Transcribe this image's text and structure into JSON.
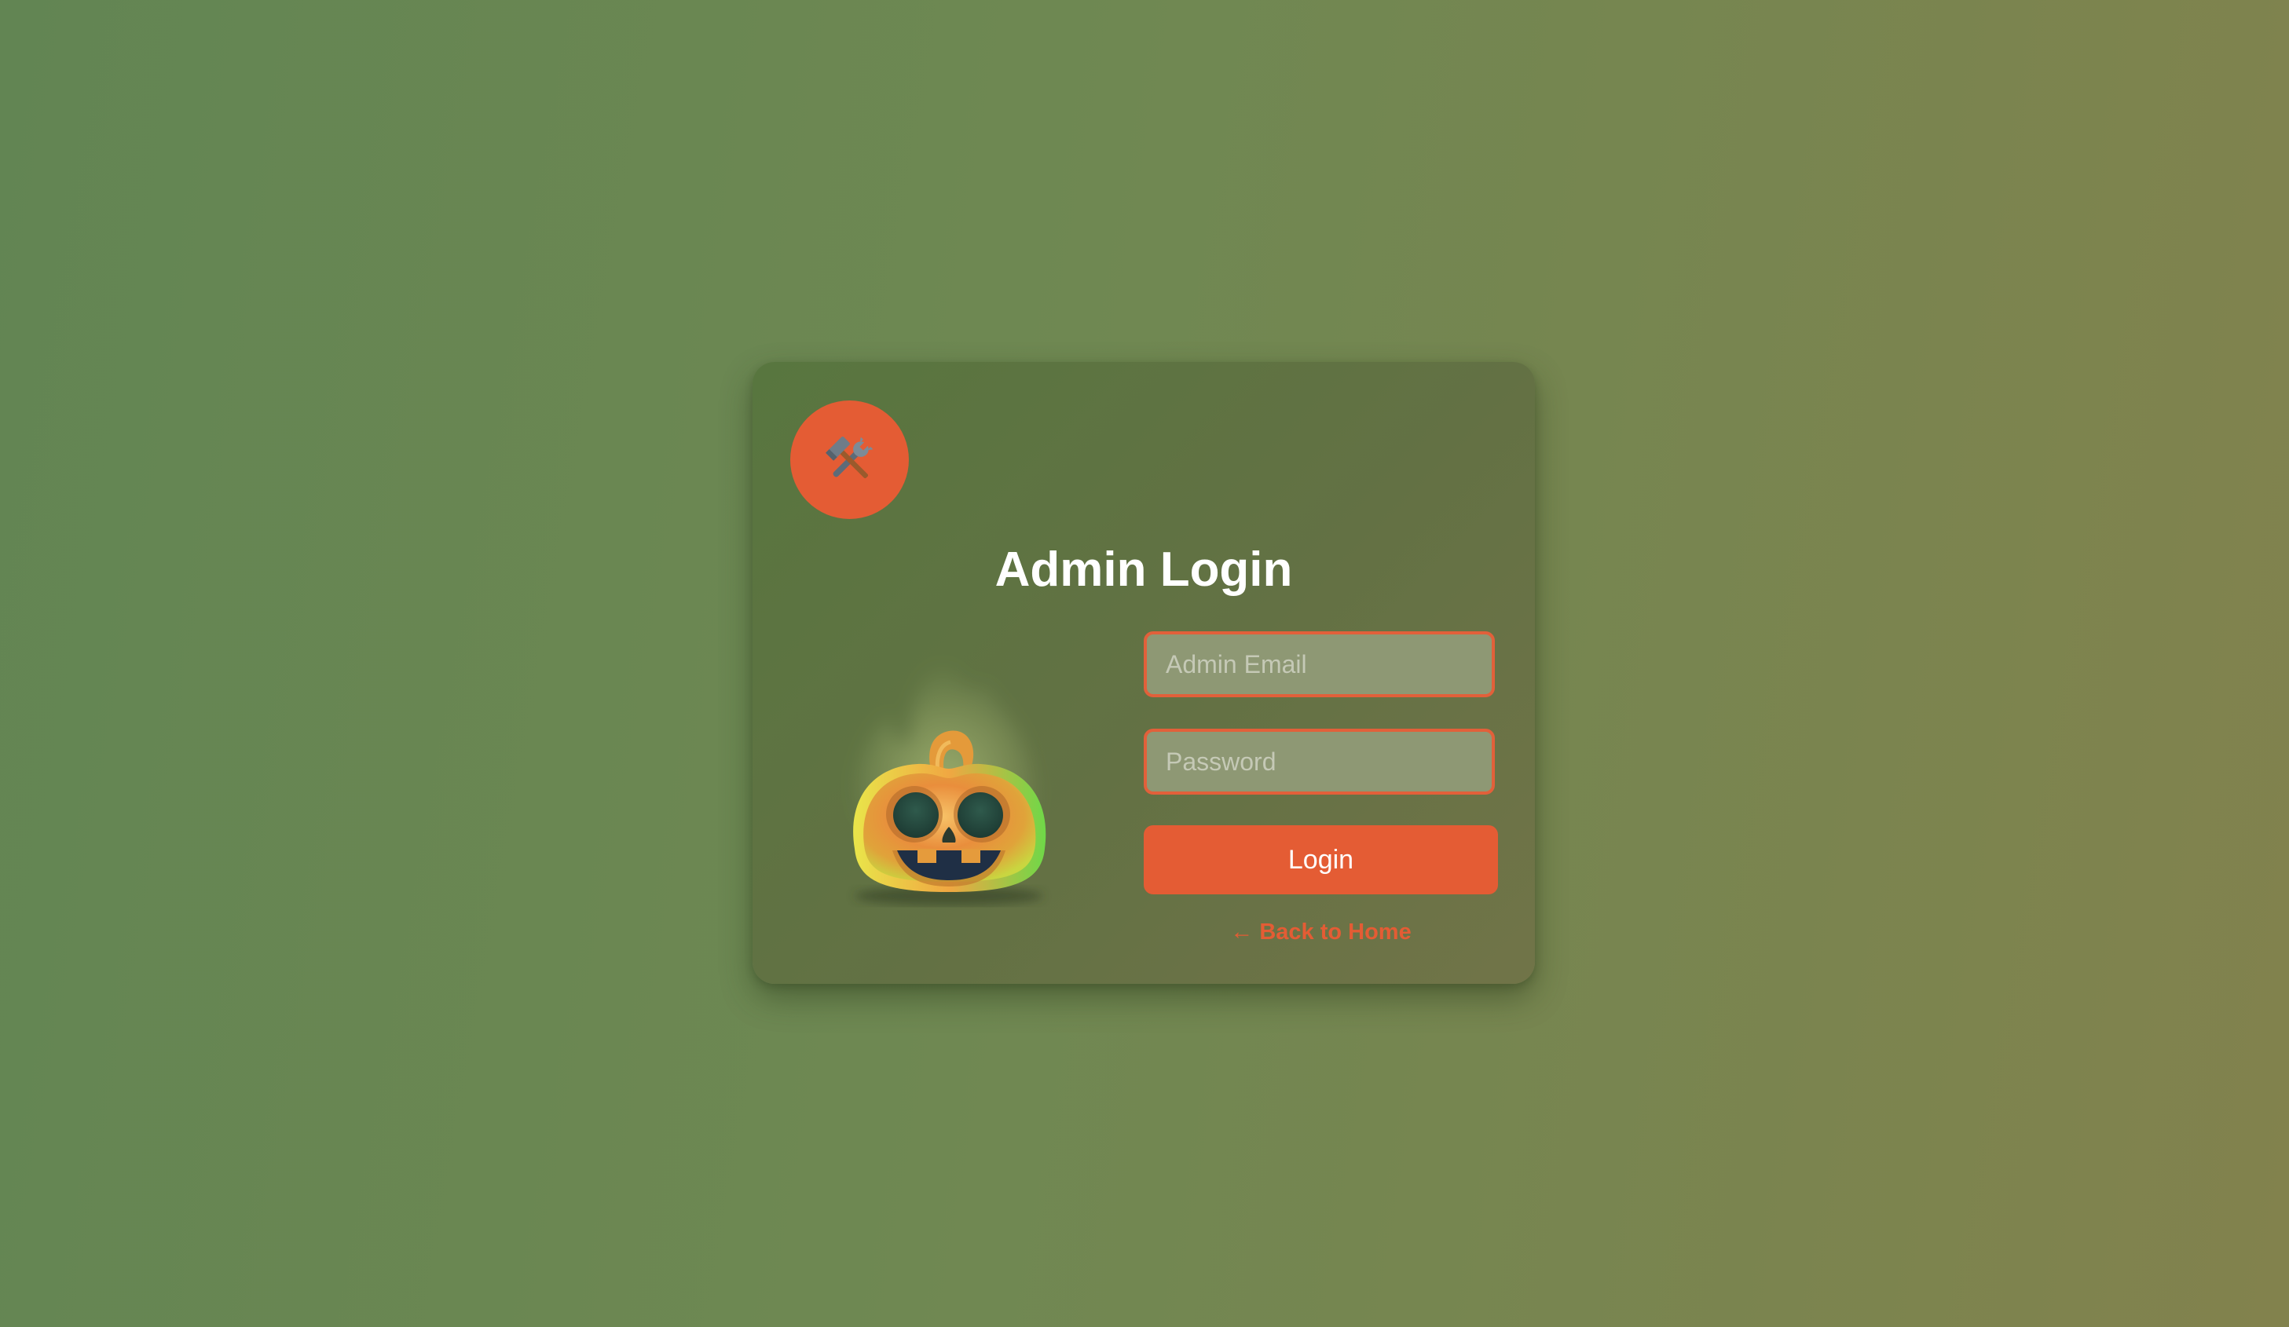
{
  "header": {
    "badge_icon": "hammer-and-wrench-icon",
    "title": "Admin Login"
  },
  "illustration": {
    "icon": "jack-o-lantern-icon"
  },
  "form": {
    "email_placeholder": "Admin Email",
    "password_placeholder": "Password",
    "login_label": "Login",
    "back_label": "← Back to Home"
  },
  "colors": {
    "accent": "#e45c34",
    "input_bg": "#8e9874",
    "card_bg": "#5f7343"
  }
}
